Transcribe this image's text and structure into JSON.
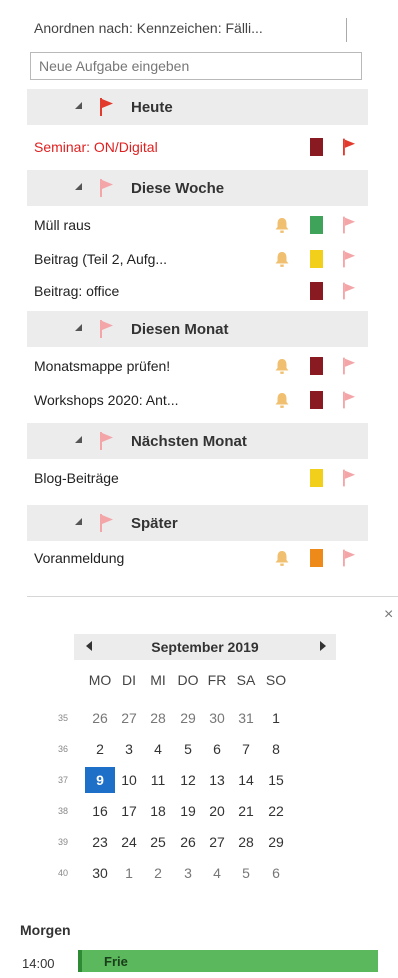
{
  "header": {
    "sort_label": "Anordnen nach: Kennzeichen: Fälli..."
  },
  "new_task": {
    "placeholder": "Neue Aufgabe eingeben"
  },
  "groups": [
    {
      "label": "Heute",
      "tasks": [
        {
          "label": "Seminar: ON/Digital",
          "overdue": true,
          "reminder": false,
          "category_color": "#8a1a22"
        }
      ]
    },
    {
      "label": "Diese Woche",
      "tasks": [
        {
          "label": "Müll raus",
          "reminder": true,
          "category_color": "#3fa35a"
        },
        {
          "label": "Beitrag (Teil 2, Aufg...",
          "reminder": true,
          "category_color": "#f2cf1a"
        },
        {
          "label": "Beitrag: office",
          "reminder": false,
          "category_color": "#8a1a22"
        }
      ]
    },
    {
      "label": "Diesen Monat",
      "tasks": [
        {
          "label": "Monatsmappe prüfen!",
          "reminder": true,
          "category_color": "#8a1a22"
        },
        {
          "label": "Workshops 2020: Ant...",
          "reminder": true,
          "category_color": "#8a1a22"
        }
      ]
    },
    {
      "label": "Nächsten Monat",
      "tasks": [
        {
          "label": "Blog-Beiträge",
          "reminder": false,
          "category_color": "#f2cf1a"
        }
      ]
    },
    {
      "label": "Später",
      "tasks": [
        {
          "label": "Voranmeldung",
          "reminder": true,
          "category_color": "#ee8a1a"
        }
      ]
    }
  ],
  "colors": {
    "flag_today": "#e23b2e",
    "flag_light": "#f3a5a8",
    "bell": "#f0c070",
    "today_highlight": "#1e6fc8",
    "agenda_free": "#5bb85c"
  },
  "calendar": {
    "title": "September 2019",
    "weekdays": [
      "MO",
      "DI",
      "MI",
      "DO",
      "FR",
      "SA",
      "SO"
    ],
    "weeks": [
      {
        "num": "35",
        "days": [
          "26",
          "27",
          "28",
          "29",
          "30",
          "31",
          "1"
        ]
      },
      {
        "num": "36",
        "days": [
          "2",
          "3",
          "4",
          "5",
          "6",
          "7",
          "8"
        ]
      },
      {
        "num": "37",
        "days": [
          "9",
          "10",
          "11",
          "12",
          "13",
          "14",
          "15"
        ]
      },
      {
        "num": "38",
        "days": [
          "16",
          "17",
          "18",
          "19",
          "20",
          "21",
          "22"
        ]
      },
      {
        "num": "39",
        "days": [
          "23",
          "24",
          "25",
          "26",
          "27",
          "28",
          "29"
        ]
      },
      {
        "num": "40",
        "days": [
          "30",
          "1",
          "2",
          "3",
          "4",
          "5",
          "6"
        ]
      }
    ],
    "selected_day": "9"
  },
  "agenda": {
    "title": "Morgen",
    "items": [
      {
        "time": "14:00",
        "label": "Frie"
      }
    ]
  }
}
